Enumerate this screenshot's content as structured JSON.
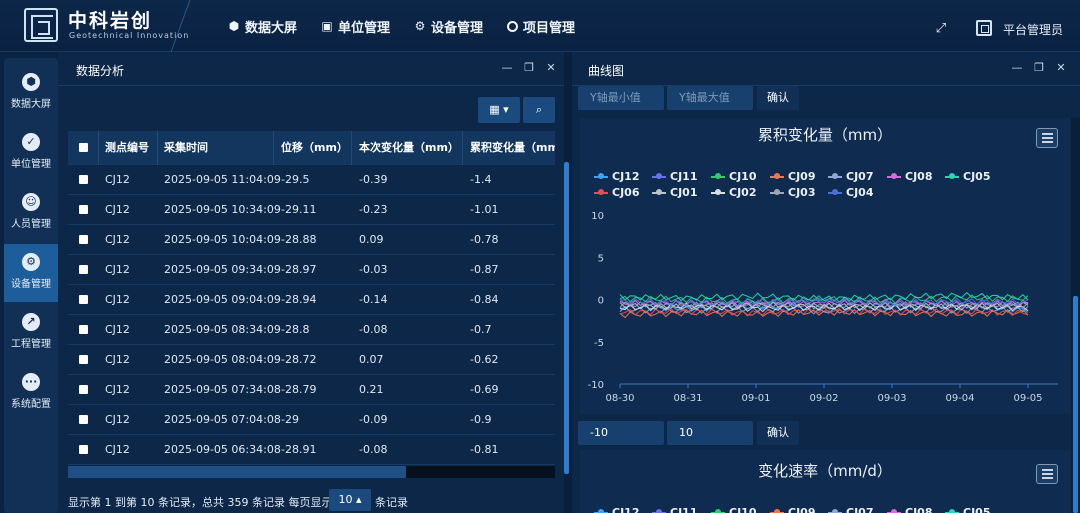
{
  "header": {
    "brand_cn": "中科岩创",
    "brand_en": "Geotechnical Innovation",
    "nav": [
      {
        "label": "数据大屏",
        "icon": "cube-icon"
      },
      {
        "label": "单位管理",
        "icon": "calendar-check-icon"
      },
      {
        "label": "设备管理",
        "icon": "gear-icon"
      },
      {
        "label": "项目管理",
        "icon": "ring-icon"
      }
    ],
    "user": "平台管理员"
  },
  "sidebar": {
    "items": [
      {
        "label": "数据大屏",
        "icon": "cube-icon",
        "active": false
      },
      {
        "label": "单位管理",
        "icon": "calendar-check-icon",
        "active": false
      },
      {
        "label": "人员管理",
        "icon": "person-id-icon",
        "active": false
      },
      {
        "label": "设备管理",
        "icon": "gear-icon",
        "active": true
      },
      {
        "label": "工程管理",
        "icon": "line-chart-icon",
        "active": false
      },
      {
        "label": "系统配置",
        "icon": "more-dots-icon",
        "active": false
      }
    ]
  },
  "left_panel": {
    "title": "数据分析",
    "table": {
      "columns": [
        "测点编号",
        "采集时间",
        "位移（mm）",
        "本次变化量（mm）",
        "累积变化量（mm"
      ],
      "rows": [
        [
          "CJ12",
          "2025-09-05 11:04:09",
          "-29.5",
          "-0.39",
          "-1.4"
        ],
        [
          "CJ12",
          "2025-09-05 10:34:09",
          "-29.11",
          "-0.23",
          "-1.01"
        ],
        [
          "CJ12",
          "2025-09-05 10:04:09",
          "-28.88",
          "0.09",
          "-0.78"
        ],
        [
          "CJ12",
          "2025-09-05 09:34:09",
          "-28.97",
          "-0.03",
          "-0.87"
        ],
        [
          "CJ12",
          "2025-09-05 09:04:09",
          "-28.94",
          "-0.14",
          "-0.84"
        ],
        [
          "CJ12",
          "2025-09-05 08:34:09",
          "-28.8",
          "-0.08",
          "-0.7"
        ],
        [
          "CJ12",
          "2025-09-05 08:04:09",
          "-28.72",
          "0.07",
          "-0.62"
        ],
        [
          "CJ12",
          "2025-09-05 07:34:08",
          "-28.79",
          "0.21",
          "-0.69"
        ],
        [
          "CJ12",
          "2025-09-05 07:04:08",
          "-29",
          "-0.09",
          "-0.9"
        ],
        [
          "CJ12",
          "2025-09-05 06:34:08",
          "-28.91",
          "-0.08",
          "-0.81"
        ]
      ]
    },
    "pager": {
      "summary": "显示第 1 到第 10 条记录，总共 359 条记录 每页显示",
      "page_size": "10 ▴",
      "suffix": "条记录"
    }
  },
  "right_panel": {
    "title": "曲线图",
    "axis_min_placeholder": "Y轴最小值",
    "axis_max_placeholder": "Y轴最大值",
    "confirm": "确认",
    "axis_min_value": "-10",
    "axis_max_value": "10",
    "chart2_title": "变化速率（mm/d）",
    "chart2_legend": [
      "CJ12",
      "CJ11",
      "CJ10",
      "CJ09",
      "CJ07",
      "CJ08",
      "CJ05"
    ]
  },
  "chart_data": {
    "type": "line",
    "title": "累积变化量（mm）",
    "ylim": [
      -10,
      10
    ],
    "yticks": [
      10,
      5,
      0,
      -5,
      -10
    ],
    "xticks": [
      "08-30",
      "08-31",
      "09-01",
      "09-02",
      "09-03",
      "09-04",
      "09-05"
    ],
    "x": [
      "08-30",
      "08-31",
      "09-01",
      "09-02",
      "09-03",
      "09-04",
      "09-05"
    ],
    "series": [
      {
        "name": "CJ12",
        "color": "#3ba3f5",
        "values": [
          -0.9,
          -1.1,
          -0.8,
          -1.0,
          -0.9,
          -0.8,
          -1.2
        ]
      },
      {
        "name": "CJ11",
        "color": "#6b6fe8",
        "values": [
          -0.3,
          -0.5,
          -0.4,
          -0.2,
          -0.5,
          -0.3,
          -0.4
        ]
      },
      {
        "name": "CJ10",
        "color": "#2ecc71",
        "values": [
          0.1,
          0.0,
          -0.2,
          0.1,
          -0.1,
          0.2,
          0.1
        ]
      },
      {
        "name": "CJ09",
        "color": "#f2784b",
        "values": [
          -1.8,
          -1.6,
          -1.7,
          -1.5,
          -1.6,
          -1.7,
          -1.5
        ]
      },
      {
        "name": "CJ07",
        "color": "#8fa8d8",
        "values": [
          -1.2,
          -1.3,
          -1.1,
          -1.4,
          -1.2,
          -1.3,
          -1.1
        ]
      },
      {
        "name": "CJ08",
        "color": "#d66bdf",
        "values": [
          -0.5,
          -0.4,
          -0.6,
          -0.5,
          -0.3,
          -0.6,
          -0.5
        ]
      },
      {
        "name": "CJ05",
        "color": "#28d7b4",
        "values": [
          0.3,
          0.2,
          0.4,
          0.1,
          0.3,
          0.5,
          0.2
        ]
      },
      {
        "name": "CJ06",
        "color": "#f04a4a",
        "values": [
          -1.5,
          -1.4,
          -1.6,
          -1.3,
          -1.5,
          -1.4,
          -1.6
        ]
      },
      {
        "name": "CJ01",
        "color": "#b9c4cf",
        "values": [
          -0.7,
          -0.9,
          -0.6,
          -0.8,
          -0.7,
          -0.9,
          -0.6
        ]
      },
      {
        "name": "CJ02",
        "color": "#d9dde3",
        "values": [
          -1.0,
          -0.8,
          -1.1,
          -0.9,
          -1.0,
          -0.8,
          -1.0
        ]
      },
      {
        "name": "CJ03",
        "color": "#9ea9b6",
        "values": [
          -0.6,
          -0.7,
          -0.5,
          -0.8,
          -0.6,
          -0.7,
          -0.6
        ]
      },
      {
        "name": "CJ04",
        "color": "#4f6fd8",
        "values": [
          -0.2,
          -0.4,
          -0.3,
          -0.1,
          -0.4,
          -0.2,
          -0.3
        ]
      }
    ]
  }
}
